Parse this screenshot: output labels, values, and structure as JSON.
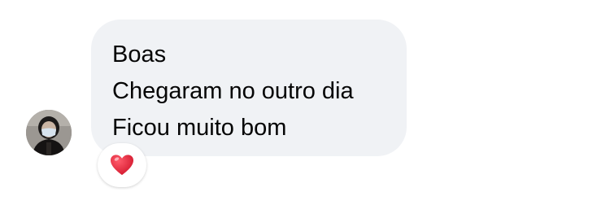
{
  "message": {
    "lines": [
      "Boas",
      "Chegaram no outro dia",
      "Ficou muito bom"
    ],
    "reaction": {
      "icon": "red-heart-icon",
      "color": "#e0182d"
    }
  },
  "colors": {
    "bubble_background": "#f0f2f5",
    "text": "#050505"
  }
}
